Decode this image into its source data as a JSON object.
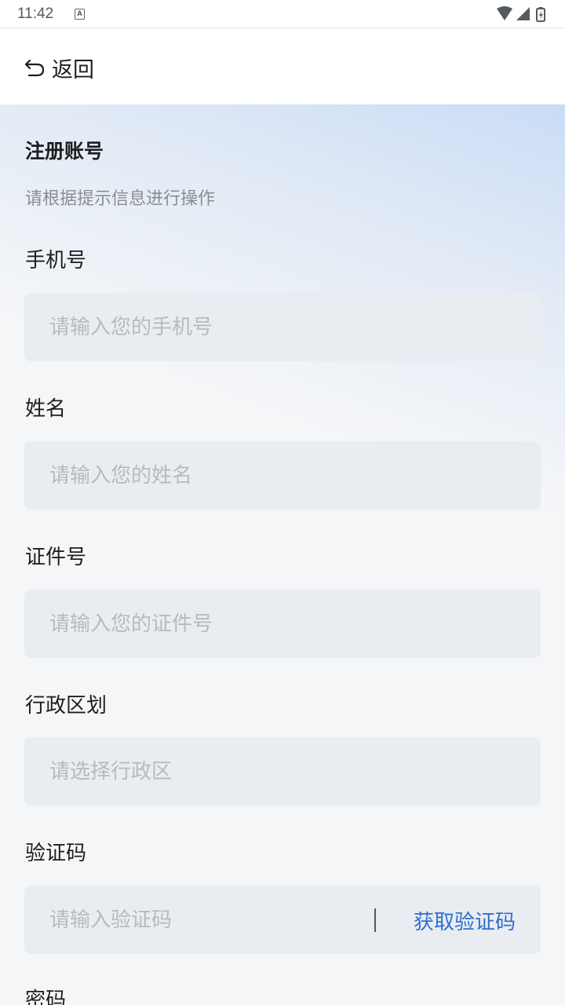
{
  "status_bar": {
    "time": "11:42",
    "icons": [
      "a-notification-icon",
      "wifi-icon",
      "cellular-signal-icon",
      "battery-charging-icon"
    ]
  },
  "header": {
    "back_label": "返回",
    "back_icon": "undo-arrow-icon"
  },
  "page": {
    "title": "注册账号",
    "subtitle": "请根据提示信息进行操作"
  },
  "form": {
    "phone": {
      "label": "手机号",
      "placeholder": "请输入您的手机号",
      "value": ""
    },
    "name": {
      "label": "姓名",
      "placeholder": "请输入您的姓名",
      "value": ""
    },
    "id_number": {
      "label": "证件号",
      "placeholder": "请输入您的证件号",
      "value": ""
    },
    "region": {
      "label": "行政区划",
      "placeholder": "请选择行政区",
      "value": ""
    },
    "code": {
      "label": "验证码",
      "placeholder": "请输入验证码",
      "value": "",
      "button_label": "获取验证码"
    },
    "password": {
      "label": "密码"
    }
  },
  "colors": {
    "accent": "#2f6fd0",
    "field_bg": "#e9ecf0",
    "placeholder": "#b7babf",
    "text": "#1c1e20",
    "subtext": "#8a8d91"
  }
}
